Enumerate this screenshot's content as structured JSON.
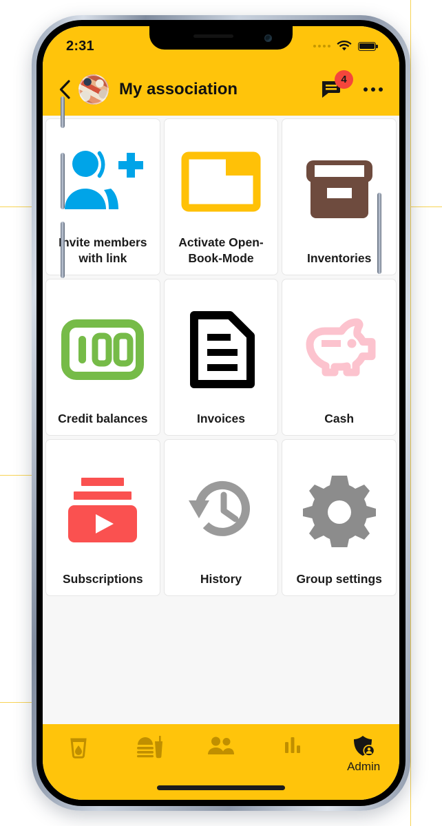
{
  "statusbar": {
    "time": "2:31",
    "signal_icon": "signal-dots-icon",
    "wifi_icon": "wifi-icon",
    "battery_icon": "battery-full-icon"
  },
  "header": {
    "back_icon": "chevron-left-icon",
    "avatar": "group-photo-avatar",
    "title": "My association",
    "chat_icon": "chat-bubble-icon",
    "badge_count": "4",
    "menu_icon": "overflow-menu-icon"
  },
  "colors": {
    "brand_yellow": "#FFC40B",
    "content_bg": "#F7F7F7",
    "badge_red": "#F4463C",
    "invite_blue": "#00A4E8",
    "folder_yellow": "#FFC107",
    "inventory_brown": "#6E4B3E",
    "credit_green": "#76BB48",
    "invoice_black": "#000000",
    "cash_pink": "#FCC3CE",
    "subscriptions_red": "#FA5150",
    "history_gray": "#9A9A9A",
    "settings_gray": "#8C8C8C",
    "nav_icon_amber": "#C08F00"
  },
  "grid": {
    "tiles": [
      {
        "label": "Invite members with link",
        "icon": "person-add-icon"
      },
      {
        "label": "Activate Open-Book-Mode",
        "icon": "folder-icon"
      },
      {
        "label": "Inventories",
        "icon": "archive-box-icon"
      },
      {
        "label": "Credit balances",
        "icon": "banknote-100-icon"
      },
      {
        "label": "Invoices",
        "icon": "document-lines-icon"
      },
      {
        "label": "Cash",
        "icon": "piggy-bank-icon"
      },
      {
        "label": "Subscriptions",
        "icon": "subscriptions-play-icon"
      },
      {
        "label": "History",
        "icon": "history-clock-icon"
      },
      {
        "label": "Group settings",
        "icon": "gear-icon"
      }
    ]
  },
  "bottomnav": {
    "items": [
      {
        "label": "",
        "icon": "drink-glass-icon",
        "active": false
      },
      {
        "label": "",
        "icon": "fast-food-icon",
        "active": false
      },
      {
        "label": "",
        "icon": "people-icon",
        "active": false
      },
      {
        "label": "",
        "icon": "bar-chart-icon",
        "active": false
      },
      {
        "label": "Admin",
        "icon": "admin-shield-icon",
        "active": true
      }
    ]
  }
}
